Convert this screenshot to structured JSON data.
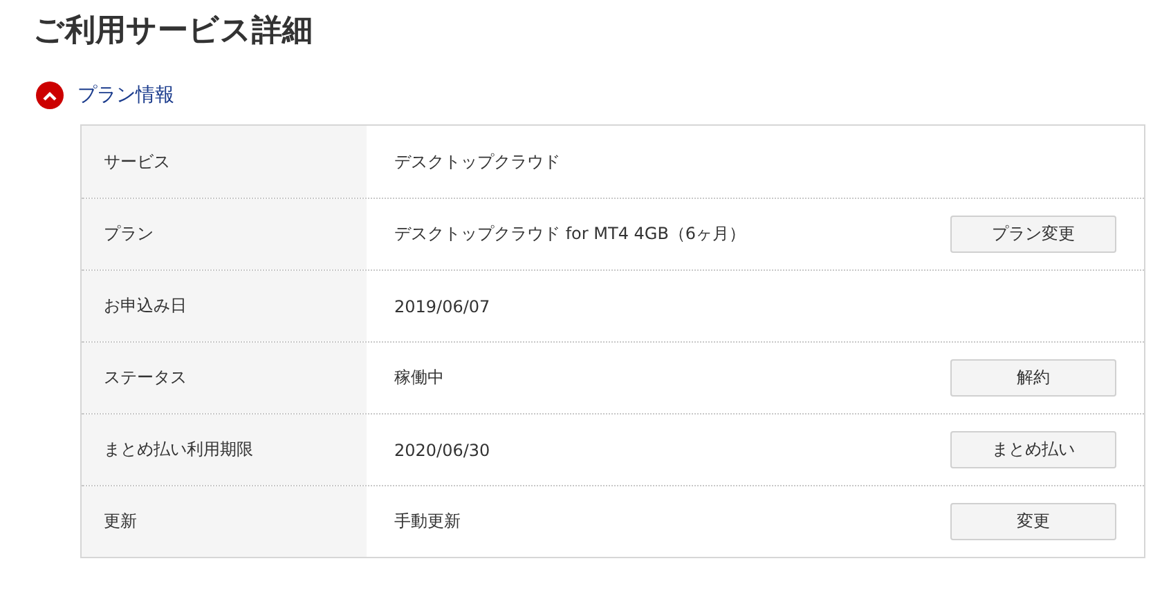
{
  "page_title": "ご利用サービス詳細",
  "section": {
    "title": "プラン情報",
    "expanded": true
  },
  "rows": [
    {
      "label": "サービス",
      "value": "デスクトップクラウド"
    },
    {
      "label": "プラン",
      "value": "デスクトップクラウド for MT4 4GB（6ヶ月）",
      "button": "プラン変更"
    },
    {
      "label": "お申込み日",
      "value": "2019/06/07"
    },
    {
      "label": "ステータス",
      "value": "稼働中",
      "button": "解約"
    },
    {
      "label": "まとめ払い利用期限",
      "value": "2020/06/30",
      "button": "まとめ払い"
    },
    {
      "label": "更新",
      "value": "手動更新",
      "button": "変更"
    }
  ]
}
